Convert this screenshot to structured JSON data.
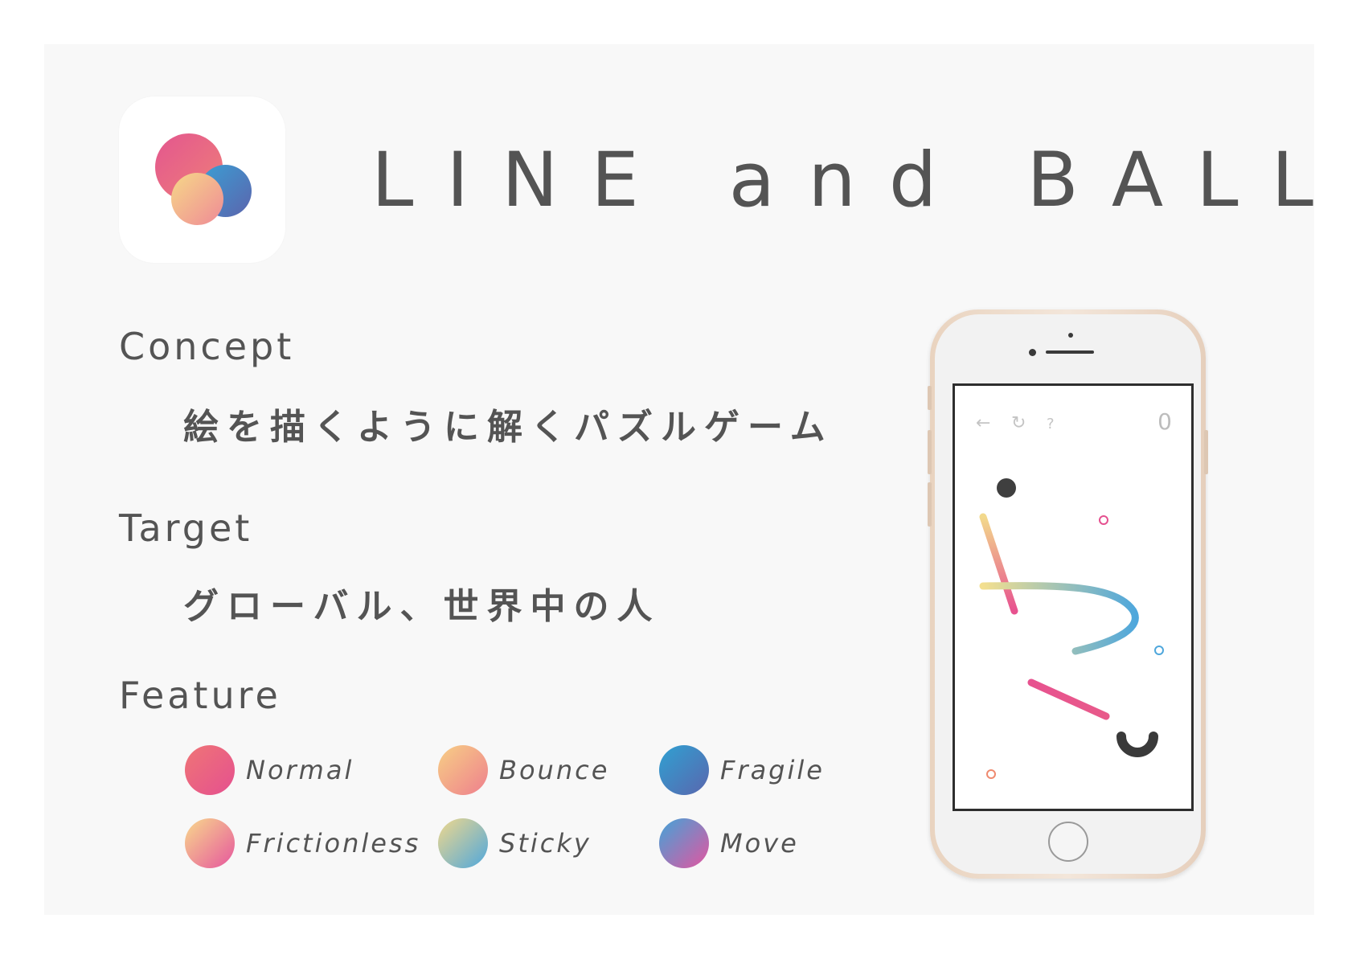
{
  "title": "LINE and BALL",
  "sections": {
    "concept": {
      "heading": "Concept",
      "body": "絵を描くように解くパズルゲーム"
    },
    "target": {
      "heading": "Target",
      "body": "グローバル、世界中の人"
    },
    "feature": {
      "heading": "Feature"
    }
  },
  "features": [
    {
      "label": "Normal",
      "colors": [
        "#ef7576",
        "#e5508f"
      ]
    },
    {
      "label": "Bounce",
      "colors": [
        "#f7cf85",
        "#ee7f8d"
      ]
    },
    {
      "label": "Fragile",
      "colors": [
        "#2fa1d2",
        "#5a66ae"
      ]
    },
    {
      "label": "Frictionless",
      "colors": [
        "#f8d98c",
        "#e6569d"
      ]
    },
    {
      "label": "Sticky",
      "colors": [
        "#f0d88c",
        "#4fa7dc"
      ]
    },
    {
      "label": "Move",
      "colors": [
        "#42a4d8",
        "#e355a0"
      ]
    }
  ],
  "phone": {
    "score": "0",
    "icons": {
      "back": "arrow-left-icon",
      "retry": "refresh-icon",
      "help": "question-icon"
    }
  },
  "colors": {
    "text": "#545454",
    "background": "#f8f8f8",
    "pink": "#e5508f",
    "blue": "#4fa7dc",
    "yellow": "#f3df8f"
  }
}
